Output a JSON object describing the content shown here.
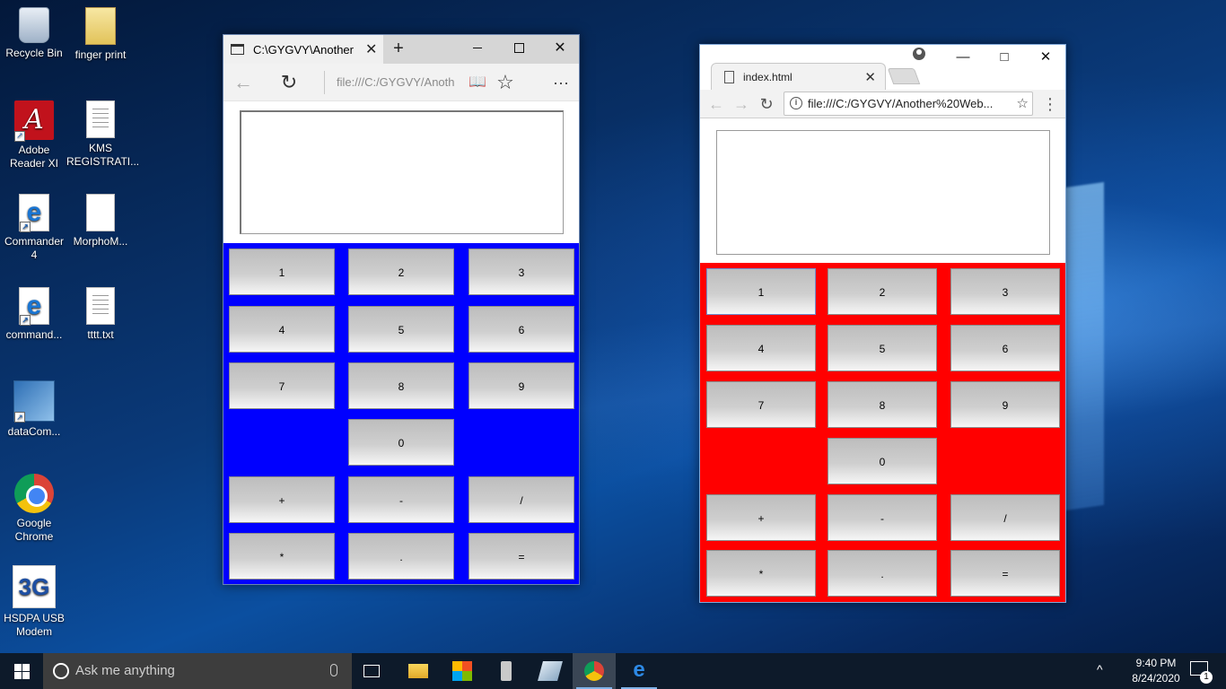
{
  "desktop": {
    "icons": [
      {
        "label": "Recycle Bin"
      },
      {
        "label": "finger print"
      },
      {
        "label": "Adobe\nReader XI"
      },
      {
        "label": "KMS\nREGISTRATI..."
      },
      {
        "label": "Commander\n4"
      },
      {
        "label": "MorphoM..."
      },
      {
        "label": "command..."
      },
      {
        "label": "tttt.txt"
      },
      {
        "label": "dataCom..."
      },
      {
        "label": "Google\nChrome"
      },
      {
        "label": "HSDPA USB\nModem"
      }
    ]
  },
  "edge_window": {
    "tab_title": "C:\\GYGVY\\Another W",
    "new_tab": "+",
    "address": "file:///C:/GYGVY/Anoth",
    "icons": {
      "back": "←",
      "refresh": "↻",
      "reading_view": "📖",
      "favorite": "☆",
      "more": "···",
      "close": "✕"
    },
    "keypad_color": "#0000ff",
    "keys": [
      "1",
      "2",
      "3",
      "4",
      "5",
      "6",
      "7",
      "8",
      "9",
      "0",
      "+",
      "-",
      "/",
      "*",
      ".",
      "="
    ]
  },
  "chrome_window": {
    "tab_title": "index.html",
    "address": "file:///C:/GYGVY/Another%20Web...",
    "icons": {
      "back": "←",
      "forward": "→",
      "reload": "↻",
      "info": "i",
      "bookmark": "☆",
      "menu": "⋮",
      "tab_close": "✕",
      "close": "✕"
    },
    "keypad_color": "#ff0000",
    "keys": [
      "1",
      "2",
      "3",
      "4",
      "5",
      "6",
      "7",
      "8",
      "9",
      "0",
      "+",
      "-",
      "/",
      "*",
      ".",
      "="
    ]
  },
  "taskbar": {
    "search_placeholder": "Ask me anything",
    "time": "9:40 PM",
    "date": "8/24/2020",
    "notification_count": "1",
    "tray_chevron": "^"
  }
}
